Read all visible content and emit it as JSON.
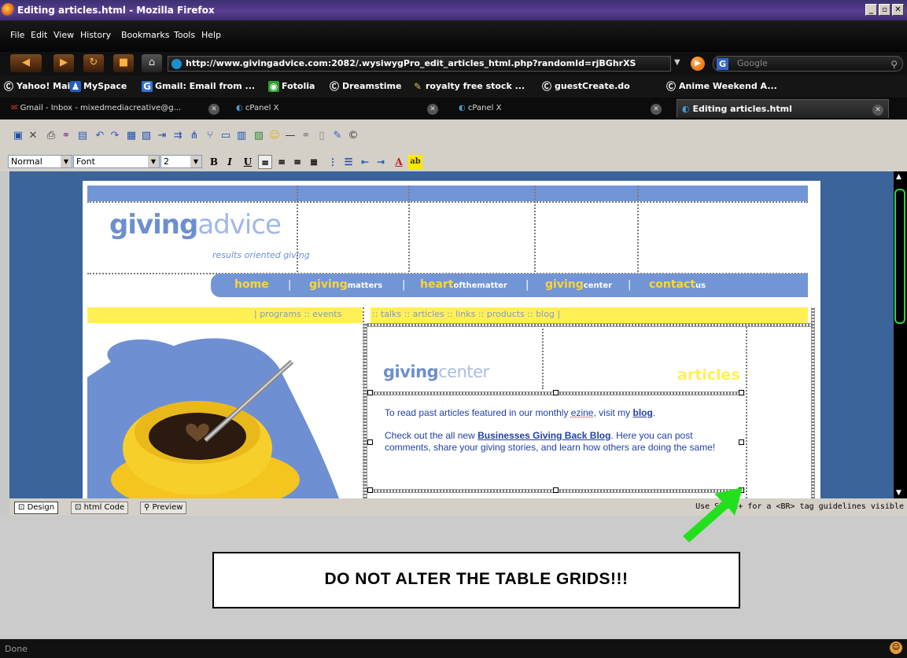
{
  "window": {
    "title": "Editing articles.html - Mozilla Firefox"
  },
  "menu": [
    "File",
    "Edit",
    "View",
    "History",
    "Bookmarks",
    "Tools",
    "Help"
  ],
  "nav": {
    "url": "http://www.givingadvice.com:2082/.wysiwygPro_edit_articles_html.php?randomId=rjBGhrXS",
    "search_placeholder": "Google"
  },
  "bookmarks": [
    "Yahoo! Mail",
    "MySpace",
    "Gmail: Email from ...",
    "Fotolia",
    "Dreamstime",
    "royalty free stock ...",
    "guestCreate.do",
    "Anime Weekend A..."
  ],
  "tabs": [
    "Gmail - Inbox - mixedmediacreative@g...",
    "cPanel X",
    "cPanel X",
    "Editing articles.html"
  ],
  "editor_toolbar": {
    "style_select": "Normal",
    "font_select": "Font",
    "size_select": "2"
  },
  "page": {
    "logo_part1": "giving",
    "logo_part2": "advice",
    "tagline": "results oriented giving",
    "nav": [
      {
        "main": "home",
        "sub": ""
      },
      {
        "main": "giving",
        "sub": "matters"
      },
      {
        "main": "heart",
        "sub": "ofthematter"
      },
      {
        "main": "giving",
        "sub": "center"
      },
      {
        "main": "contact",
        "sub": "us"
      }
    ],
    "left_links": "|   programs  ::  events",
    "right_links": ":: talks  :: articles  :: links  :: products  :: blog   |",
    "section_title_a": "giving",
    "section_title_b": "center",
    "section_label": "articles",
    "para1_pre": "To read past articles featured in our monthly ",
    "para1_ezine": "ezine",
    "para1_mid": ", visit my ",
    "para1_link": "blog",
    "para1_post": ".",
    "para2_pre": "Check out the all new ",
    "para2_link": "Businesses Giving Back Blog",
    "para2_post": ". Here you can post comments, share your giving stories, and learn how others are doing the same!"
  },
  "mode_tabs": [
    "Design",
    "html Code",
    "Preview"
  ],
  "hint_text": "Use Shift+   for a <BR> tag  guidelines visible",
  "warning": "DO NOT ALTER THE TABLE GRIDS!!!",
  "status": "Done"
}
